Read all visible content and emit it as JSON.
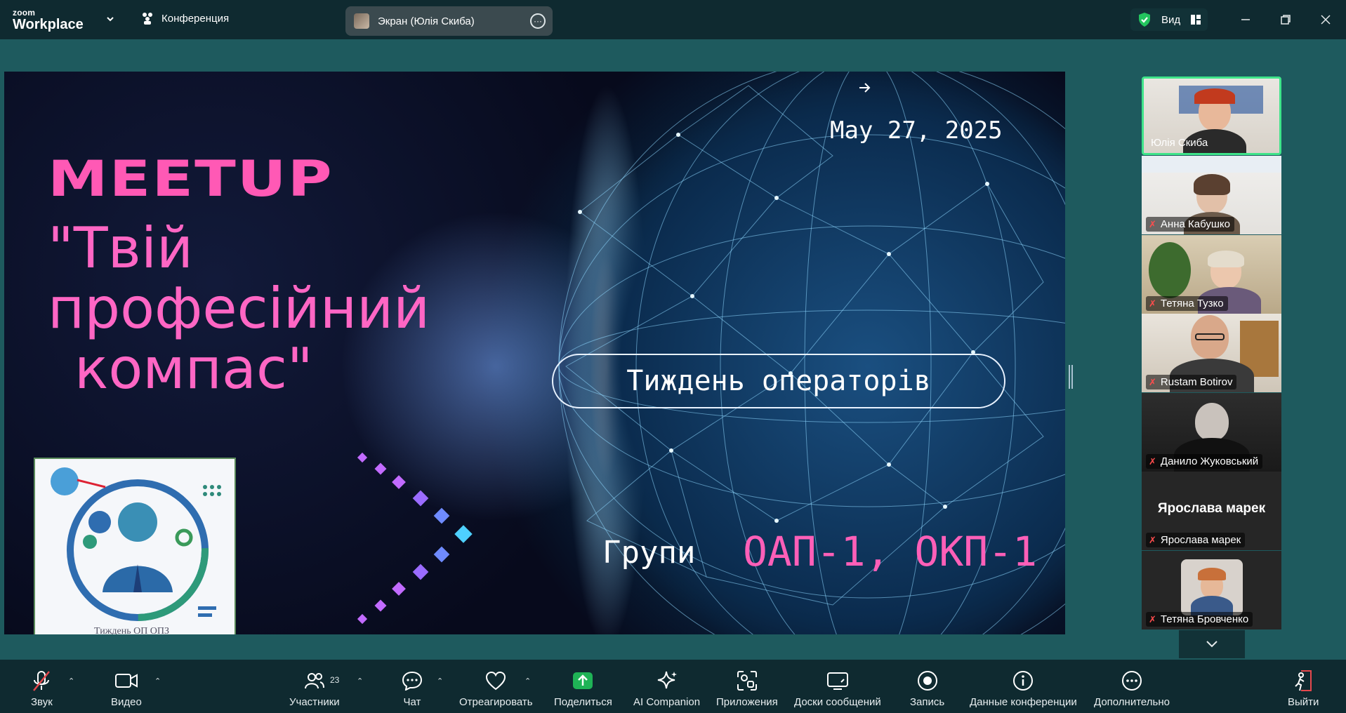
{
  "app": {
    "brand_top": "zoom",
    "brand_name": "Workplace",
    "conference_tab": "Конференция",
    "share_label": "Экран (Юлія Скиба)",
    "view_label": "Вид"
  },
  "slide": {
    "heading": "MEETUP",
    "title_line1": "\"Твій",
    "title_line2": "професійний",
    "title_line3": "компас\"",
    "date": "May 27, 2025",
    "operators": "Тиждень операторів",
    "groups_label": "Групи",
    "groups_value": "ОАП-1, ОКП-1",
    "logo_caption": "Тиждень ОП ОПЗ"
  },
  "participants": [
    {
      "name": "Юлія Скиба",
      "muted": false,
      "active": true
    },
    {
      "name": "Анна Кабушко",
      "muted": true
    },
    {
      "name": "Тетяна Тузко",
      "muted": true
    },
    {
      "name": "Rustam Botirov",
      "muted": true
    },
    {
      "name": "Данило Жуковський",
      "muted": true
    },
    {
      "name": "Ярослава марек",
      "muted": true,
      "display_name": "Ярослава марек"
    },
    {
      "name": "Тетяна Бровченко",
      "muted": true
    }
  ],
  "toolbar": {
    "audio": "Звук",
    "video": "Видео",
    "participants": "Участники",
    "participants_count": "23",
    "chat": "Чат",
    "react": "Отреагировать",
    "share": "Поделиться",
    "ai": "AI Companion",
    "apps": "Приложения",
    "whiteboards": "Доски сообщений",
    "record": "Запись",
    "info": "Данные конференции",
    "more": "Дополнительно",
    "leave": "Выйти"
  },
  "colors": {
    "accent_green": "#3fe48a",
    "share_green": "#1fb356",
    "leave_red": "#e5484d",
    "slide_pink": "#ff59b5"
  }
}
